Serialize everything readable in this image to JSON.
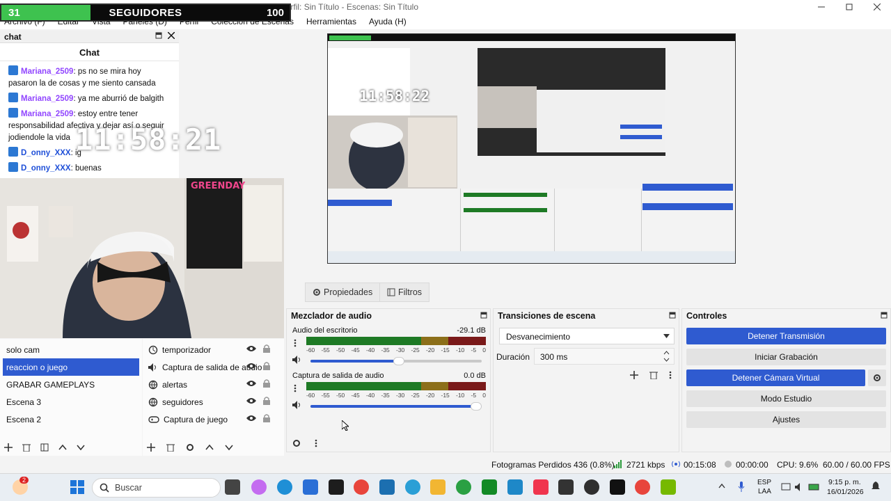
{
  "window": {
    "title": "OBS 32.0.4 - Perfil: Sin Título - Escenas: Sin Título"
  },
  "menu": [
    "Archivo (F)",
    "Editar",
    "Vista",
    "Paneles (D)",
    "Perfil",
    "Colección de Escenas",
    "Herramientas",
    "Ayuda (H)"
  ],
  "followers": {
    "current": "31",
    "label": "SEGUIDORES",
    "goal": "100",
    "progress": 0.31,
    "bar_color": "#3ec24f"
  },
  "chat": {
    "dock_title": "chat",
    "title": "Chat",
    "messages": [
      {
        "user": "Mariana_2509",
        "text": ": ps no se mira hoy pasaron la de cosas y me siento cansada",
        "color": "#9146ff"
      },
      {
        "user": "Mariana_2509",
        "text": ": ya me aburrió de balgith",
        "color": "#9146ff"
      },
      {
        "user": "Mariana_2509",
        "text": ": estoy entre tener responsabilidad afectiva y dejar así o seguir jodiendole la vida",
        "color": "#9146ff"
      },
      {
        "user": "D_onny_XXX",
        "text": ": ig",
        "color": "#1e4fd8"
      },
      {
        "user": "D_onny_XXX",
        "text": ": buenas",
        "color": "#1e4fd8"
      }
    ]
  },
  "clock": "11:58:21",
  "nested_clock": "11:58:22",
  "poster_text": "GREENDAY",
  "tabs": {
    "properties": "Propiedades",
    "filters": "Filtros"
  },
  "scenes": {
    "items": [
      "solo cam",
      "reaccion o juego",
      "GRABAR GAMEPLAYS",
      "Escena 3",
      "Escena 2"
    ],
    "selected": 1
  },
  "sources": {
    "items": [
      {
        "name": "temporizador",
        "icon": "clock-icon"
      },
      {
        "name": "Captura de salida de audio",
        "icon": "speaker-icon"
      },
      {
        "name": "alertas",
        "icon": "browser-icon"
      },
      {
        "name": "seguidores",
        "icon": "browser-icon"
      },
      {
        "name": "Captura de juego",
        "icon": "gamepad-icon"
      }
    ]
  },
  "mixer": {
    "title": "Mezclador de audio",
    "scale": [
      "-60",
      "-55",
      "-50",
      "-45",
      "-40",
      "-35",
      "-30",
      "-25",
      "-20",
      "-15",
      "-10",
      "-5",
      "0"
    ],
    "channels": [
      {
        "name": "Audio del escritorio",
        "db": "-29.1 dB",
        "level": 0.55
      },
      {
        "name": "Captura de salida de audio",
        "db": "0.0 dB",
        "level": 1.0
      }
    ]
  },
  "transitions": {
    "title": "Transiciones de escena",
    "selected": "Desvanecimiento",
    "duration_label": "Duración",
    "duration": "300 ms"
  },
  "controls": {
    "title": "Controles",
    "buttons": [
      "Detener Transmisión",
      "Iniciar Grabación",
      "Detener Cámara Virtual",
      "Modo Estudio",
      "Ajustes"
    ]
  },
  "status": {
    "dropped": "Fotogramas Perdidos 436 (0.8%)",
    "bitrate": "2721 kbps",
    "stream_time": "00:15:08",
    "rec_time": "00:00:00",
    "cpu": "CPU: 9.6%",
    "fps": "60.00 / 60.00 FPS"
  },
  "taskbar": {
    "search": "Buscar",
    "lang": "ESP",
    "layout": "LAA",
    "time": "9:15 p. m.",
    "date": "16/01/2026",
    "badge": "2"
  },
  "colors": {
    "accent": "#2f5bd0"
  }
}
